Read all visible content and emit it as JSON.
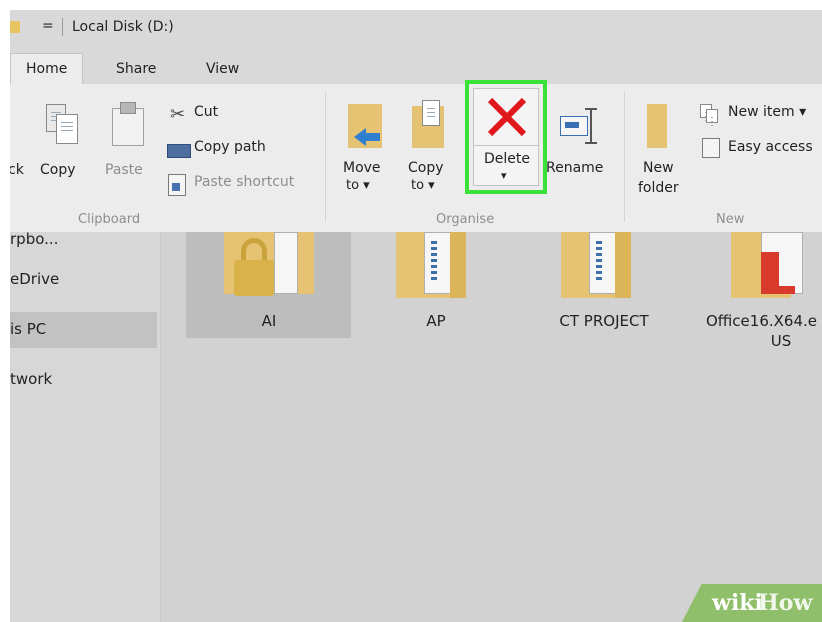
{
  "window": {
    "title": "Local Disk (D:)",
    "quick_access_glyph": "="
  },
  "tabs": [
    {
      "label": "Home"
    },
    {
      "label": "Share"
    },
    {
      "label": "View"
    }
  ],
  "ribbon": {
    "clipboard": {
      "group_label": "Clipboard",
      "pin_label_partial": "ck",
      "copy_label": "Copy",
      "paste_label": "Paste",
      "cut_label": "Cut",
      "copy_path_label": "Copy path",
      "paste_shortcut_label": "Paste shortcut"
    },
    "organise": {
      "group_label": "Organise",
      "move_to_label": "Move",
      "move_to_sub": "to ▾",
      "copy_to_label": "Copy",
      "copy_to_sub": "to ▾",
      "delete_label": "Delete",
      "delete_dropdown": "▾",
      "rename_label": "Rename"
    },
    "new": {
      "group_label": "New",
      "new_folder_label": "New",
      "new_folder_sub": "folder",
      "new_item_label": "New item ▾",
      "easy_access_label": "Easy access"
    }
  },
  "nav_pane": {
    "items": [
      {
        "label": "rpbo..."
      },
      {
        "label": "eDrive"
      },
      {
        "label": "is PC"
      },
      {
        "label": "twork"
      }
    ]
  },
  "files": [
    {
      "name": "AI",
      "type": "locked-folder"
    },
    {
      "name": "AP",
      "type": "folder"
    },
    {
      "name": "CT PROJECT",
      "type": "folder"
    },
    {
      "name": "Office16.X64.e",
      "name_line2": "US",
      "type": "folder"
    }
  ],
  "watermark": {
    "wiki": "wiki",
    "how": "How"
  },
  "colors": {
    "highlight_box": "#39e139",
    "delete_x": "#e0171b",
    "folder": "#e6c372"
  }
}
